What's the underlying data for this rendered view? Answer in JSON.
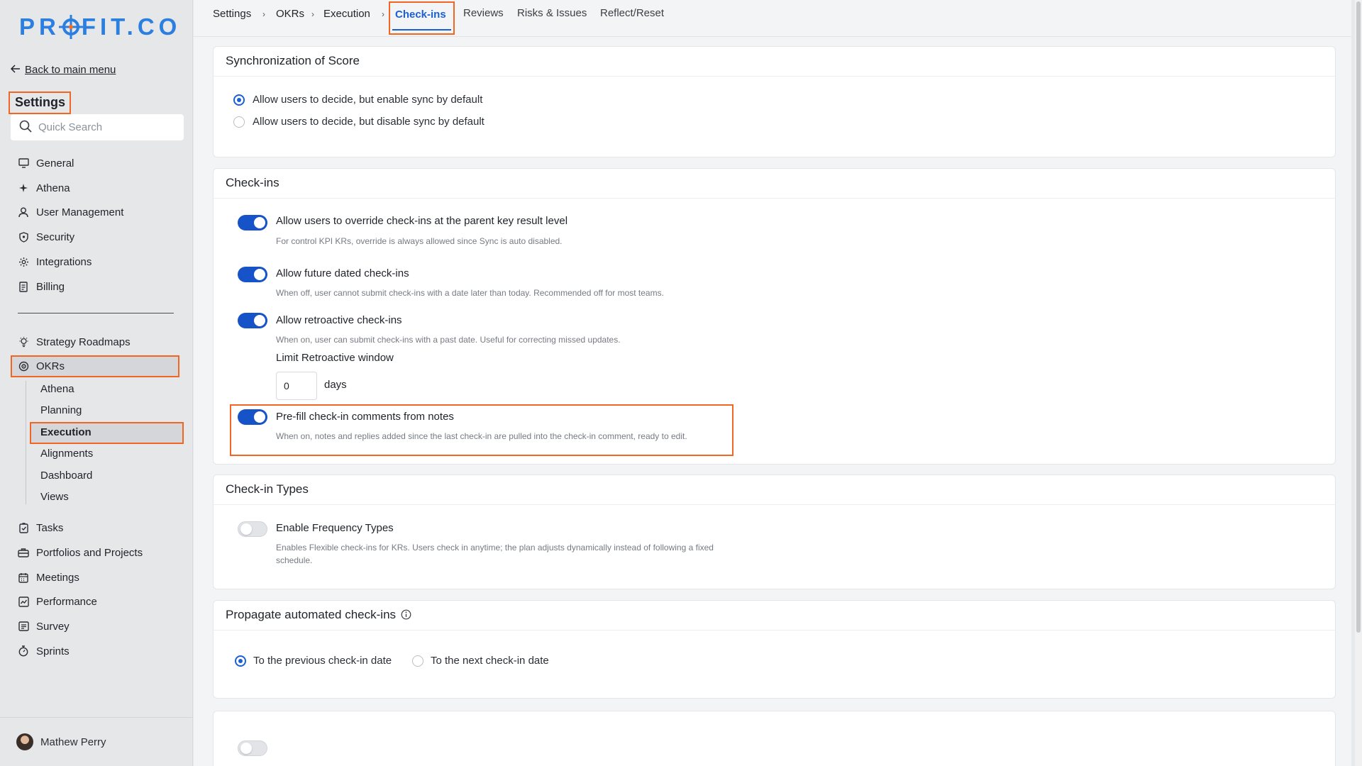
{
  "brand": {
    "logo": "PROFIT.CO",
    "logo_left": "PR",
    "logo_right": "FIT.CO",
    "accent": "#2b7fe0",
    "highlight": "#f26522"
  },
  "sidebar": {
    "back_label": "Back to main menu",
    "title": "Settings",
    "search_placeholder": "Quick Search",
    "top_items": [
      {
        "label": "General",
        "icon": "monitor-icon"
      },
      {
        "label": "Athena",
        "icon": "sparkle-icon"
      },
      {
        "label": "User Management",
        "icon": "user-icon"
      },
      {
        "label": "Security",
        "icon": "shield-icon"
      },
      {
        "label": "Integrations",
        "icon": "gear-icon"
      },
      {
        "label": "Billing",
        "icon": "receipt-icon"
      }
    ],
    "strategy_label": "Strategy Roadmaps",
    "okrs_label": "OKRs",
    "okrs_sub": [
      "Athena",
      "Planning",
      "Execution",
      "Alignments",
      "Dashboard",
      "Views"
    ],
    "bottom_items": [
      {
        "label": "Tasks",
        "icon": "clipboard-icon"
      },
      {
        "label": "Portfolios and Projects",
        "icon": "briefcase-icon"
      },
      {
        "label": "Meetings",
        "icon": "calendar-icon"
      },
      {
        "label": "Performance",
        "icon": "chart-icon"
      },
      {
        "label": "Survey",
        "icon": "survey-icon"
      },
      {
        "label": "Sprints",
        "icon": "stopwatch-icon"
      }
    ],
    "user_name": "Mathew Perry"
  },
  "breadcrumb": [
    "Settings",
    "OKRs",
    "Execution"
  ],
  "tabs": {
    "active": "Check-ins",
    "others": [
      "Reviews",
      "Risks & Issues",
      "Reflect/Reset"
    ]
  },
  "sync": {
    "title": "Synchronization of Score",
    "options": [
      "Allow users to decide, but enable sync by default",
      "Allow users to decide, but disable sync by default"
    ],
    "selected": 0
  },
  "checkins": {
    "title": "Check-ins",
    "override": {
      "title": "Allow users to override check-ins at the parent key result level",
      "desc": "For control KPI KRs, override is always allowed since Sync is auto disabled.",
      "on": true
    },
    "future": {
      "title": "Allow future dated check-ins",
      "desc": "When off, user cannot submit check-ins with a date later than today. Recommended off for most teams.",
      "on": true
    },
    "retro": {
      "title": "Allow retroactive check-ins",
      "desc": "When on, user can submit check-ins with a past date. Useful for correcting missed updates.",
      "on": true
    },
    "limit_label": "Limit Retroactive window",
    "limit_value": "0",
    "limit_unit": "days",
    "prefill": {
      "title": "Pre-fill check-in comments from notes",
      "desc": "When on, notes and replies added since the last check-in are pulled into the check-in comment, ready to edit.",
      "on": true
    }
  },
  "types": {
    "title": "Check-in Types",
    "freq": {
      "title": "Enable Frequency Types",
      "desc1": "Enables Flexible check-ins for KRs. Users check in anytime; the plan adjusts dynamically instead of following a fixed",
      "desc2": "schedule.",
      "on": false
    }
  },
  "propagate": {
    "title": "Propagate automated check-ins",
    "options": [
      "To the previous check-in date",
      "To the next check-in date"
    ],
    "selected": 0
  }
}
